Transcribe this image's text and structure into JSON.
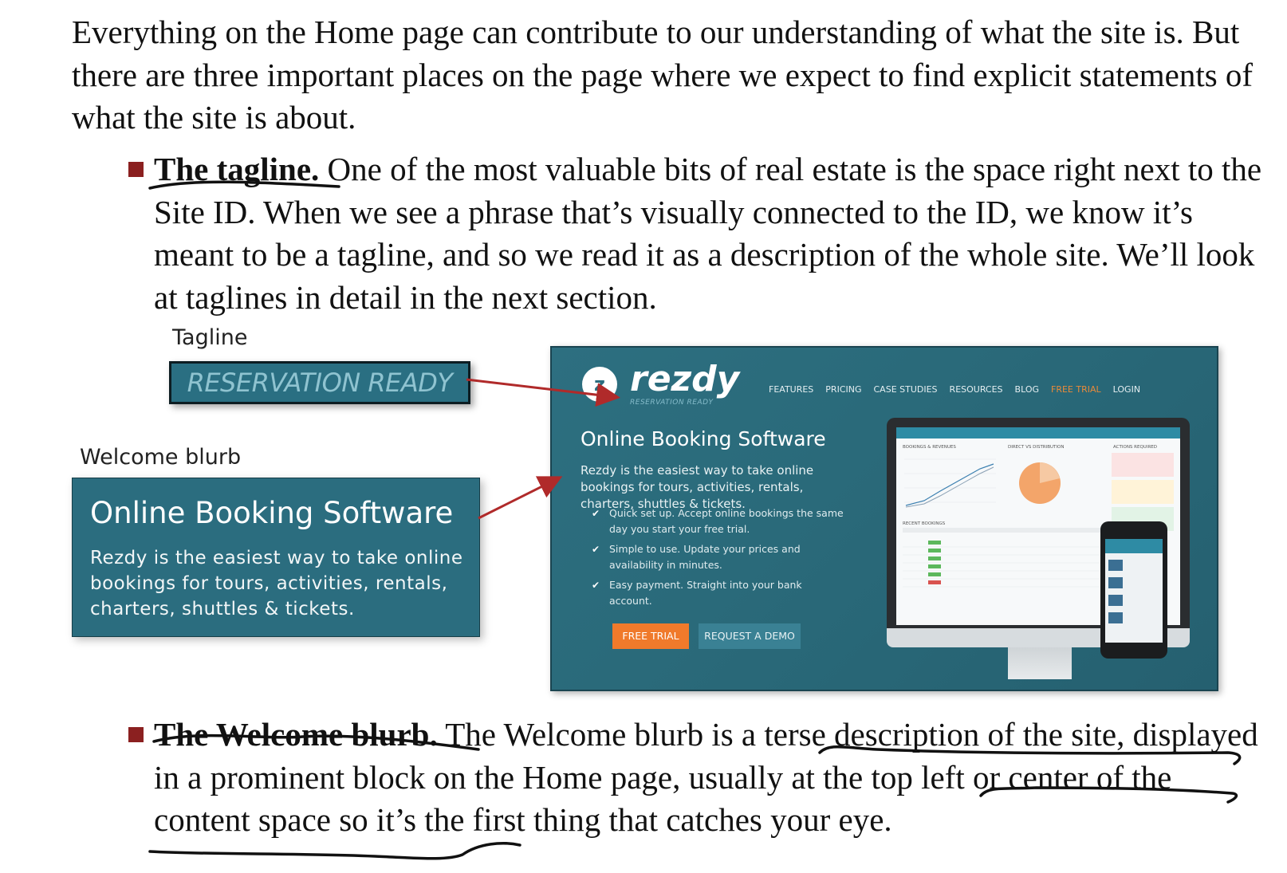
{
  "intro": "Everything on the Home page can contribute to our understanding of what the site is. But there are three important places on the page where we expect to find explicit statements of what the site is about.",
  "bullet1": {
    "title": "The tagline.",
    "body": " One of the most valuable bits of real estate is the space right next to the Site ID. When we see a phrase that’s visually connected to the ID, we know it’s meant to be a tagline, and so we read it as a description of the whole site. We’ll look at taglines in detail in the next section."
  },
  "figure": {
    "tagline_label": "Tagline",
    "tagline_text": "RESERVATION READY",
    "welcome_label": "Welcome blurb",
    "blurb_title": "Online Booking Software",
    "blurb_text": "Rezdy is the easiest way to take online bookings for tours, activities, rentals, charters, shuttles & tickets.",
    "site": {
      "logo_mark": "z",
      "logo_word": "rezdy",
      "logo_tagline": "RESERVATION READY",
      "nav": [
        "FEATURES",
        "PRICING",
        "CASE STUDIES",
        "RESOURCES",
        "BLOG",
        "FREE TRIAL",
        "LOGIN"
      ],
      "heading": "Online Booking Software",
      "text": "Rezdy is the easiest way to take online bookings for tours, activities, rentals, charters, shuttles & tickets.",
      "checks": [
        "Quick set up. Accept online bookings the same day you start your free trial.",
        "Simple to use. Update your prices and availability in minutes.",
        "Easy payment. Straight into your bank account."
      ],
      "free_trial_button": "FREE TRIAL",
      "demo_button": "REQUEST A DEMO",
      "dashboard": {
        "bookings_label": "BOOKINGS & REVENUES",
        "distribution_label": "DIRECT VS DISTRIBUTION",
        "actions_label": "ACTIONS REQUIRED",
        "recent_label": "RECENT BOOKINGS"
      }
    },
    "colors": {
      "teal": "#2b6d7f",
      "orange": "#f07a2b",
      "bullet": "#8b2020",
      "arrow": "#b02a2a"
    }
  },
  "bullet2": {
    "title": "The Welcome blurb.",
    "body": " The Welcome blurb is a terse description of the site, displayed in a prominent block on the Home page, usually at the top left or center of the content space so it’s the first thing that catches your eye."
  }
}
